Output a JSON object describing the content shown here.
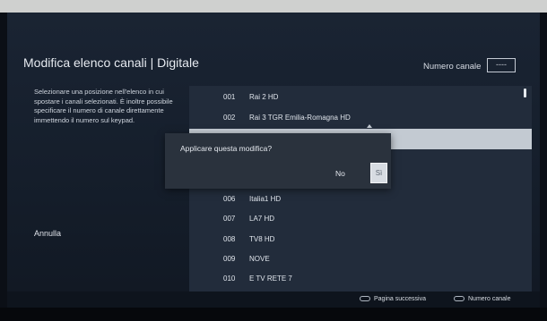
{
  "header": {
    "title": "Modifica elenco canali | Digitale",
    "channel_number_label": "Numero canale",
    "channel_number_value": "----"
  },
  "instructions": "Selezionare una posizione nell'elenco in cui spostare i canali selezionati. È inoltre possibile specificare il numero di canale direttamente immettendo il numero sul keypad.",
  "cancel_label": "Annulla",
  "channels": [
    {
      "num": "001",
      "name": "Rai 2 HD"
    },
    {
      "num": "002",
      "name": "Rai 3 TGR Emilia-Romagna HD"
    },
    {
      "num": "006",
      "name": "Italia1 HD"
    },
    {
      "num": "007",
      "name": "LA7 HD"
    },
    {
      "num": "008",
      "name": "TV8 HD"
    },
    {
      "num": "009",
      "name": "NOVE"
    },
    {
      "num": "010",
      "name": "E TV RETE 7"
    }
  ],
  "dialog": {
    "question": "Applicare questa modifica?",
    "no_label": "No",
    "yes_label": "Sì"
  },
  "footer": {
    "next_page": "Pagina successiva",
    "channel_number": "Numero canale"
  },
  "colors": {
    "background": "#151e2b",
    "list_background": "#222c3b",
    "selection": "#c3cad2",
    "dialog": "#2a323d"
  }
}
